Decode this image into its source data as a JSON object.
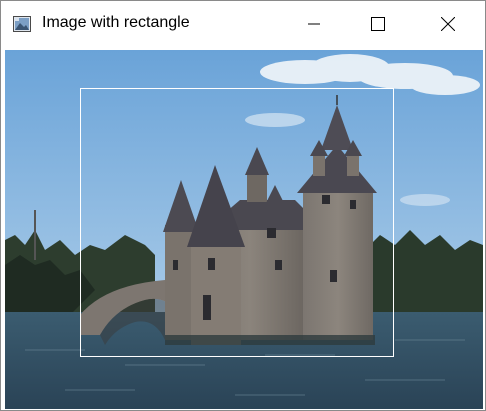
{
  "window": {
    "title": "Image with rectangle",
    "icon": "app-image-icon"
  },
  "titlebar_buttons": {
    "minimize": "minimize-icon",
    "maximize": "maximize-icon",
    "close": "close-icon"
  },
  "canvas": {
    "subject": "castle-by-lake-photo",
    "overlay": "white-rectangle-outline",
    "overlay_color": "#ffffff",
    "sky_color": "#7fb0dd",
    "water_color": "#2f4c5e"
  }
}
